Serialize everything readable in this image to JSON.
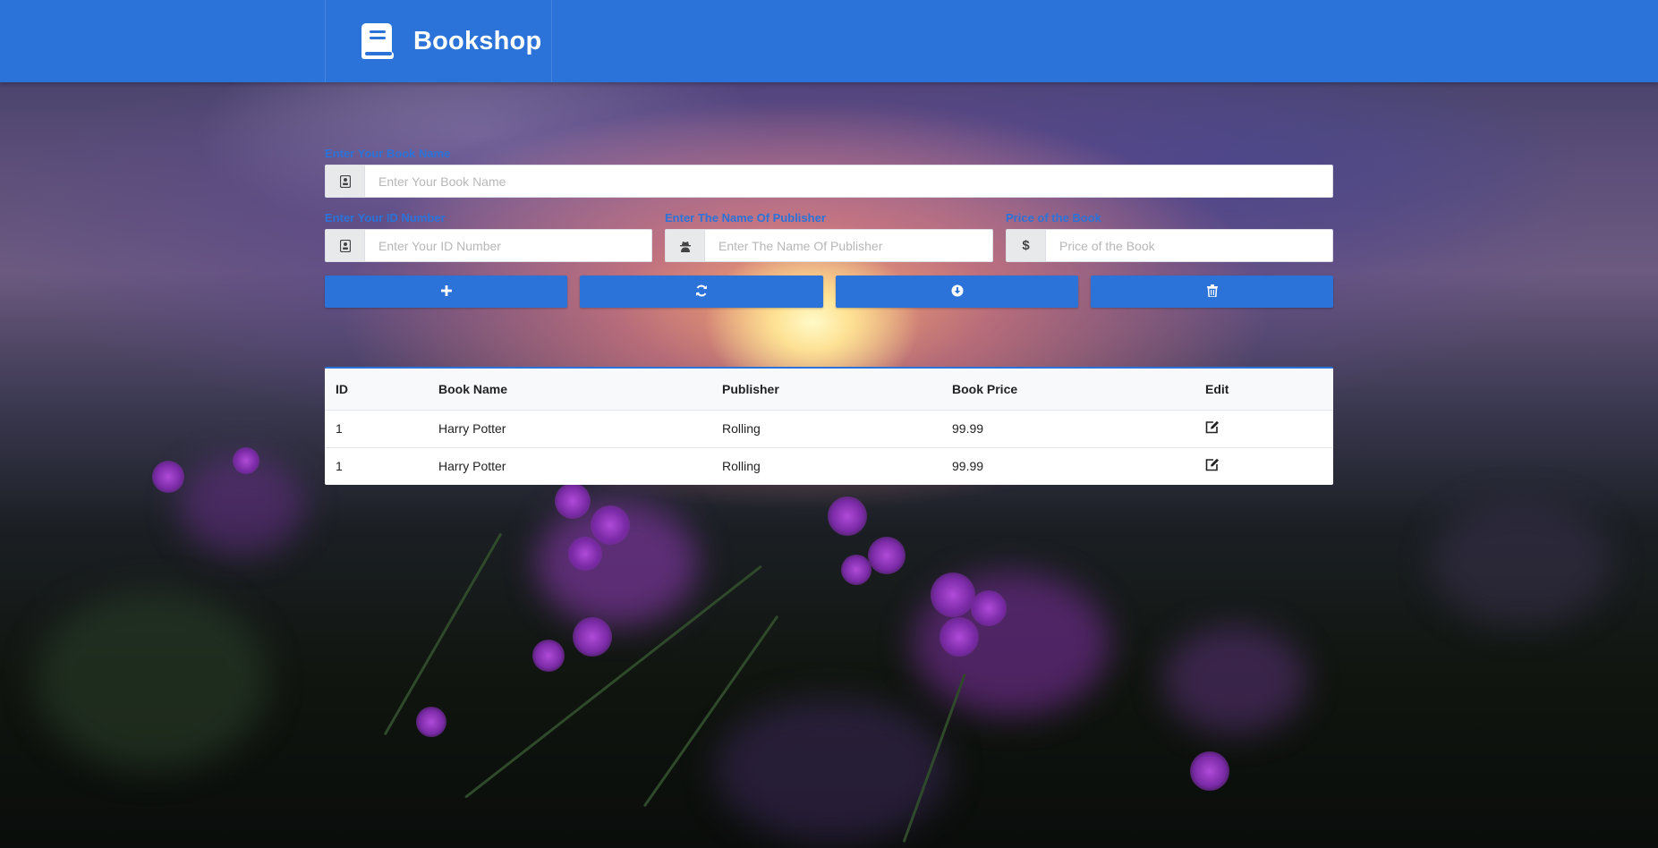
{
  "app": {
    "title": "Bookshop",
    "brand_icon": "book-icon",
    "accent": "#2b73d9"
  },
  "form": {
    "book_name": {
      "label": "Enter Your Book Name",
      "placeholder": "Enter Your Book Name",
      "value": "",
      "icon": "contact-card-icon"
    },
    "id_number": {
      "label": "Enter Your ID Number",
      "placeholder": "Enter Your ID Number",
      "value": "",
      "icon": "contact-card-icon"
    },
    "publisher": {
      "label": "Enter The Name Of Publisher",
      "placeholder": "Enter The Name Of Publisher",
      "value": "",
      "icon": "user-secret-icon"
    },
    "price": {
      "label": "Price of the Book",
      "placeholder": "Price of the Book",
      "value": "",
      "icon": "dollar-icon",
      "icon_glyph": "$"
    }
  },
  "actions": [
    {
      "icon": "plus-icon"
    },
    {
      "icon": "refresh-icon"
    },
    {
      "icon": "download-circle-icon"
    },
    {
      "icon": "trash-icon"
    }
  ],
  "table": {
    "columns": [
      "ID",
      "Book Name",
      "Publisher",
      "Book Price",
      "Edit"
    ],
    "rows": [
      {
        "id": "1",
        "name": "Harry Potter",
        "publisher": "Rolling",
        "price": "99.99",
        "edit_icon": "edit-icon"
      },
      {
        "id": "1",
        "name": "Harry Potter",
        "publisher": "Rolling",
        "price": "99.99",
        "edit_icon": "edit-icon"
      }
    ]
  }
}
